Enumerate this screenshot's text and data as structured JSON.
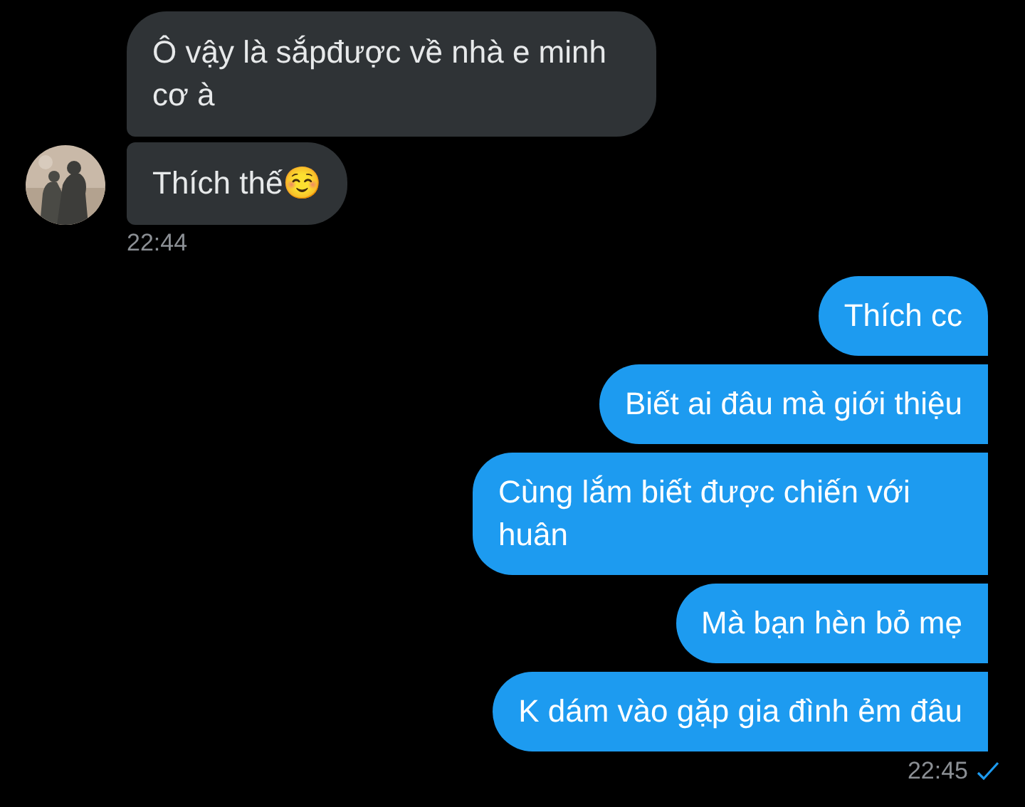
{
  "groups": [
    {
      "kind": "received",
      "messages": [
        "Ô vậy là sắpđược về nhà e minh cơ à",
        "Thích thế☺️"
      ],
      "time": "22:44"
    },
    {
      "kind": "sent",
      "messages": [
        "Thích cc",
        "Biết ai đâu mà giới thiệu",
        "Cùng lắm biết được chiến với huân",
        "Mà bạn hèn bỏ mẹ",
        "K dám vào gặp gia đình ẻm đâu"
      ],
      "time": "22:45",
      "read": true
    }
  ]
}
